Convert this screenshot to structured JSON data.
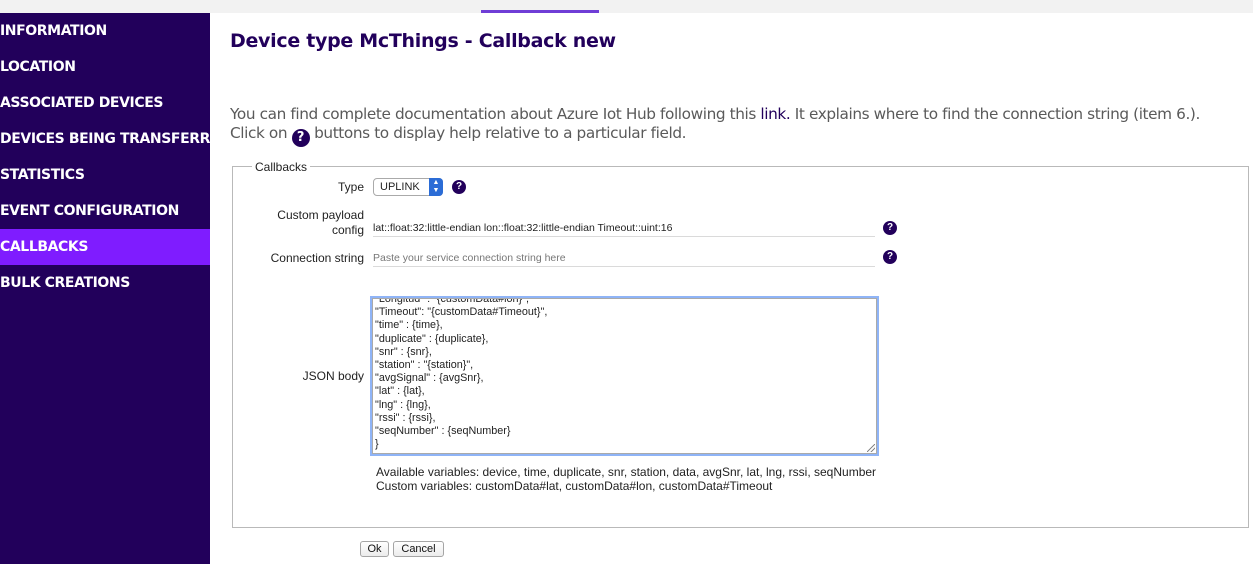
{
  "sidebar": {
    "items": [
      {
        "label": "INFORMATION"
      },
      {
        "label": "LOCATION"
      },
      {
        "label": "ASSOCIATED DEVICES"
      },
      {
        "label": "DEVICES BEING TRANSFERRED"
      },
      {
        "label": "STATISTICS"
      },
      {
        "label": "EVENT CONFIGURATION"
      },
      {
        "label": "CALLBACKS",
        "active": true
      },
      {
        "label": "BULK CREATIONS"
      }
    ]
  },
  "page": {
    "title": "Device type McThings - Callback new",
    "intro_part1": "You can find complete documentation about Azure Iot Hub following this ",
    "intro_link": "link.",
    "intro_part2": " It explains where to find the connection string (item 6.).",
    "intro_line2a": "Click on ",
    "intro_line2b": " buttons to display help relative to a particular field.",
    "help_glyph": "?"
  },
  "form": {
    "legend": "Callbacks",
    "type_label": "Type",
    "type_value": "UPLINK",
    "payload_label_line1": "Custom payload",
    "payload_label_line2": "config",
    "payload_value": "lat::float:32:little-endian lon::float:32:little-endian Timeout::uint:16",
    "connection_label": "Connection string",
    "connection_placeholder": "Paste your service connection string here",
    "json_label": "JSON body",
    "json_lines": [
      "\"Longitud\" : \"{customData#lon}\",",
      "\"Timeout\": \"{customData#Timeout}\",",
      "\"time\" : {time},",
      "\"duplicate\" : {duplicate},",
      "\"snr\" : {snr},",
      "\"station\" : \"{station}\",",
      "\"avgSignal\" : {avgSnr},",
      "\"lat\" : {lat},",
      "\"lng\" : {lng},",
      "\"rssi\" : {rssi},",
      "\"seqNumber\" : {seqNumber}",
      "}"
    ],
    "available_vars": "Available variables: device, time, duplicate, snr, station, data, avgSnr, lat, lng, rssi, seqNumber",
    "custom_vars": "Custom variables: customData#lat, customData#lon, customData#Timeout"
  },
  "buttons": {
    "ok": "Ok",
    "cancel": "Cancel"
  },
  "colors": {
    "sidebar_bg": "#22005b",
    "active_item": "#7f1cff",
    "title": "#22005b"
  }
}
